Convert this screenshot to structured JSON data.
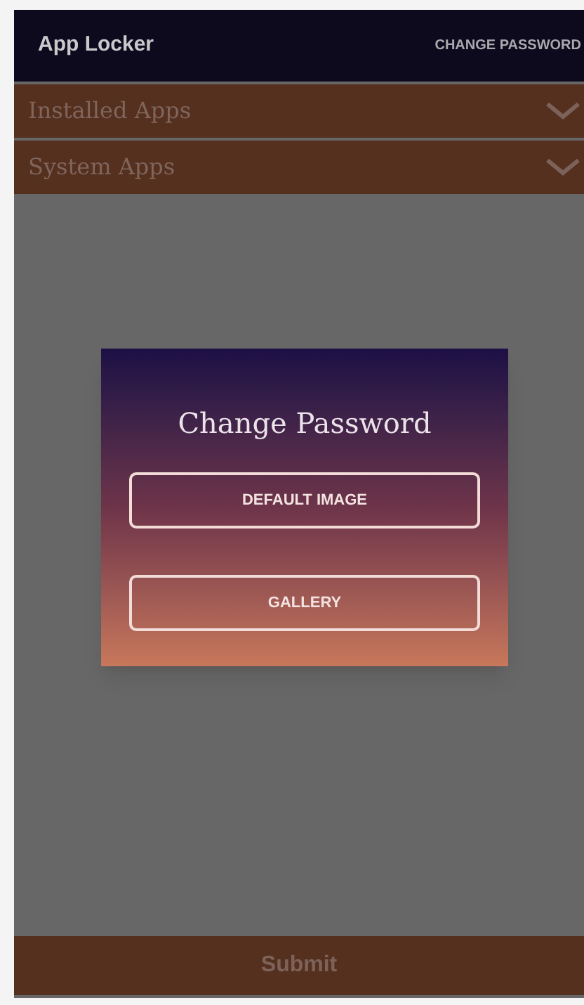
{
  "app_bar": {
    "title": "App Locker",
    "action": "CHANGE PASSWORD"
  },
  "sections": [
    {
      "label": "Installed Apps",
      "expanded": false
    },
    {
      "label": "System Apps",
      "expanded": false
    }
  ],
  "dialog": {
    "title": "Change Password",
    "buttons": [
      "DEFAULT IMAGE",
      "GALLERY"
    ]
  },
  "submit": "Submit"
}
